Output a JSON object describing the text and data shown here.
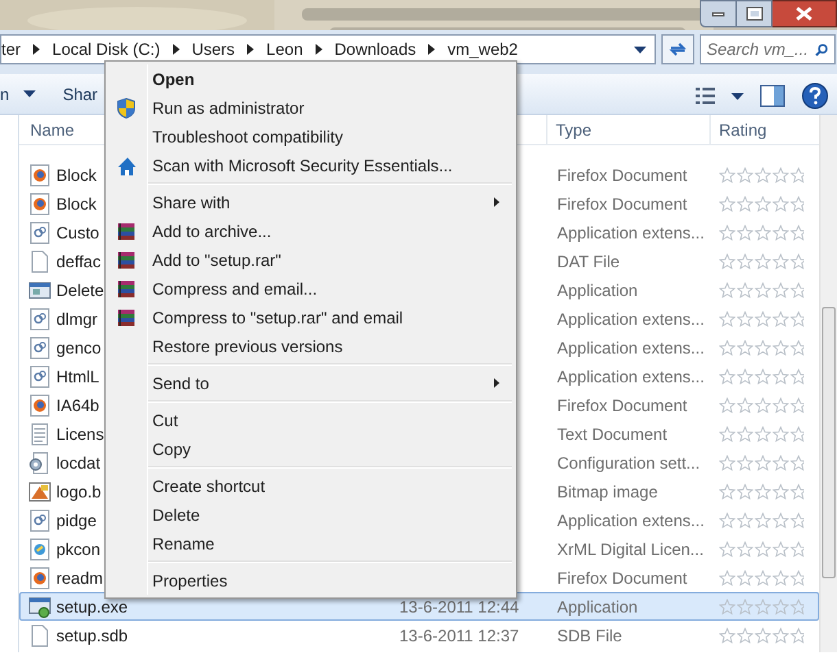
{
  "address_bar": {
    "crumbs": [
      "ter",
      "Local Disk (C:)",
      "Users",
      "Leon",
      "Downloads",
      "vm_web2"
    ]
  },
  "search": {
    "placeholder": "Search vm_..."
  },
  "toolbar": {
    "items": [
      "n",
      "Shar"
    ]
  },
  "columns": [
    "Name",
    "Type",
    "Rating"
  ],
  "files": [
    {
      "name": "Block",
      "type": "Firefox Document",
      "kind": "firefox",
      "stars": 0,
      "selected": false
    },
    {
      "name": "Block",
      "type": "Firefox Document",
      "kind": "firefox",
      "stars": 0,
      "selected": false
    },
    {
      "name": "Custo",
      "type": "Application extens...",
      "kind": "extension",
      "stars": 0,
      "selected": false
    },
    {
      "name": "deffac",
      "type": "DAT File",
      "kind": "blank",
      "stars": 0,
      "selected": false
    },
    {
      "name": "Delete",
      "type": "Application",
      "kind": "program",
      "stars": 0,
      "selected": false
    },
    {
      "name": "dlmgr",
      "type": "Application extens...",
      "kind": "extension",
      "stars": 0,
      "selected": false
    },
    {
      "name": "genco",
      "type": "Application extens...",
      "kind": "extension",
      "stars": 0,
      "selected": false
    },
    {
      "name": "HtmlL",
      "type": "Application extens...",
      "kind": "extension",
      "stars": 0,
      "selected": false
    },
    {
      "name": "IA64b",
      "type": "Firefox Document",
      "kind": "firefox",
      "stars": 0,
      "selected": false
    },
    {
      "name": "Licens",
      "type": "Text Document",
      "kind": "text",
      "stars": 0,
      "selected": false
    },
    {
      "name": "locdat",
      "type": "Configuration sett...",
      "kind": "config",
      "stars": 0,
      "selected": false
    },
    {
      "name": "logo.b",
      "type": "Bitmap image",
      "kind": "bitmap",
      "stars": 0,
      "selected": false
    },
    {
      "name": "pidge",
      "type": "Application extens...",
      "kind": "extension",
      "stars": 0,
      "selected": false
    },
    {
      "name": "pkcon",
      "type": "XrML Digital Licen...",
      "kind": "license",
      "stars": 0,
      "selected": false
    },
    {
      "name": "readm",
      "type": "Firefox Document",
      "kind": "firefox",
      "stars": 0,
      "selected": false
    },
    {
      "name": "setup.exe",
      "date": "13-6-2011 12:44",
      "type": "Application",
      "kind": "setup",
      "stars": 0,
      "selected": true
    },
    {
      "name": "setup.sdb",
      "date": "13-6-2011 12:37",
      "type": "SDB File",
      "kind": "blank",
      "stars": 0,
      "selected": false
    }
  ],
  "context_menu": {
    "groups": [
      [
        {
          "label": "Open",
          "kind": "plain",
          "default": true,
          "submenu": false
        },
        {
          "label": "Run as administrator",
          "kind": "elevated",
          "default": false,
          "submenu": false
        },
        {
          "label": "Troubleshoot compatibility",
          "kind": "plain",
          "default": false,
          "submenu": false
        },
        {
          "label": "Scan with Microsoft Security Essentials...",
          "kind": "antivirus",
          "default": false,
          "submenu": false
        }
      ],
      [
        {
          "label": "Share with",
          "kind": "plain",
          "default": false,
          "submenu": true
        },
        {
          "label": "Add to archive...",
          "kind": "archiver",
          "default": false,
          "submenu": false
        },
        {
          "label": "Add to \"setup.rar\"",
          "kind": "archiver",
          "default": false,
          "submenu": false
        },
        {
          "label": "Compress and email...",
          "kind": "archiver",
          "default": false,
          "submenu": false
        },
        {
          "label": "Compress to \"setup.rar\" and email",
          "kind": "archiver",
          "default": false,
          "submenu": false
        },
        {
          "label": "Restore previous versions",
          "kind": "plain",
          "default": false,
          "submenu": false
        }
      ],
      [
        {
          "label": "Send to",
          "kind": "plain",
          "default": false,
          "submenu": true
        }
      ],
      [
        {
          "label": "Cut",
          "kind": "plain",
          "default": false,
          "submenu": false
        },
        {
          "label": "Copy",
          "kind": "plain",
          "default": false,
          "submenu": false
        }
      ],
      [
        {
          "label": "Create shortcut",
          "kind": "plain",
          "default": false,
          "submenu": false
        },
        {
          "label": "Delete",
          "kind": "plain",
          "default": false,
          "submenu": false
        },
        {
          "label": "Rename",
          "kind": "plain",
          "default": false,
          "submenu": false
        }
      ],
      [
        {
          "label": "Properties",
          "kind": "plain",
          "default": false,
          "submenu": false
        }
      ]
    ]
  }
}
